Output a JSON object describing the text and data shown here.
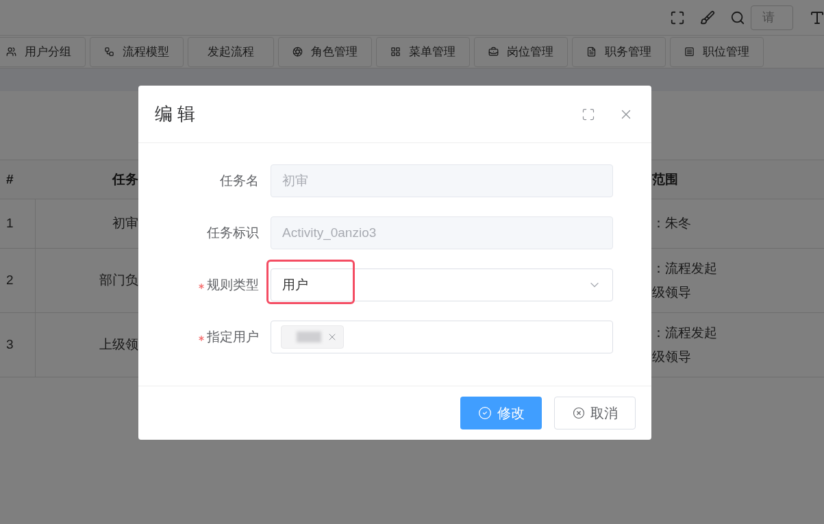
{
  "toolbar": {
    "search": {
      "placeholder": "请"
    }
  },
  "tabs": [
    {
      "label": "用户分组"
    },
    {
      "label": "流程模型"
    },
    {
      "label": "发起流程"
    },
    {
      "label": "角色管理"
    },
    {
      "label": "菜单管理"
    },
    {
      "label": "岗位管理"
    },
    {
      "label": "职务管理"
    },
    {
      "label": "职位管理"
    }
  ],
  "table": {
    "columns": [
      "#",
      "任务",
      "范围"
    ],
    "rows": [
      {
        "index": "1",
        "name": "初审",
        "scope": [
          "：朱冬"
        ]
      },
      {
        "index": "2",
        "name": "部门负",
        "scope": [
          "：流程发起",
          "级领导"
        ]
      },
      {
        "index": "3",
        "name": "上级领",
        "scope": [
          "：流程发起",
          "级领导"
        ]
      }
    ]
  },
  "dialog": {
    "title": "编 辑",
    "fields": [
      {
        "kind": "input",
        "label": "任务名",
        "required": false,
        "disabled": true,
        "value": "初审"
      },
      {
        "kind": "input",
        "label": "任务标识",
        "required": false,
        "disabled": true,
        "value": "Activity_0anzio3"
      },
      {
        "kind": "select",
        "label": "规则类型",
        "required": true,
        "value": "用户",
        "highlighted": true
      },
      {
        "kind": "tags",
        "label": "指定用户",
        "required": true,
        "tags": [
          {
            "kind": "blurred"
          }
        ]
      }
    ],
    "buttons": [
      {
        "label": "修改",
        "kind": "primary"
      },
      {
        "label": "取消",
        "kind": "default"
      }
    ]
  }
}
